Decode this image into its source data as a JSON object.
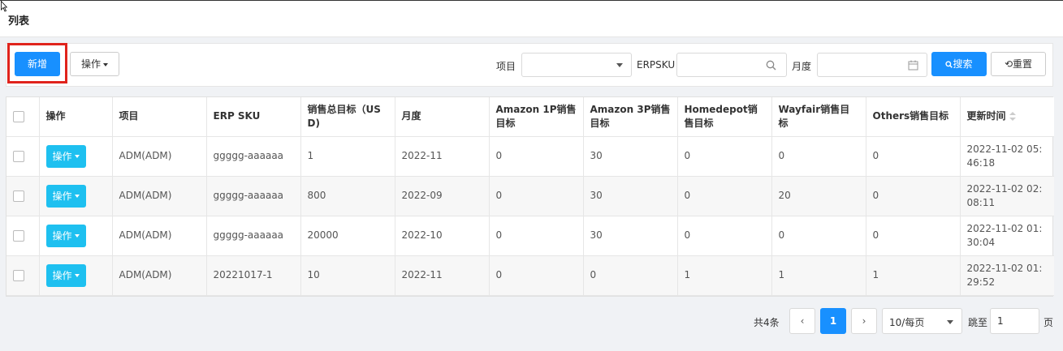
{
  "page": {
    "title": "列表"
  },
  "toolbar": {
    "add_label": "新增",
    "ops_label": "操作",
    "filters": {
      "project_label": "项目",
      "project_value": "",
      "erpsku_label": "ERPSKU",
      "erpsku_value": "",
      "month_label": "月度",
      "month_value": ""
    },
    "search_label": "搜索",
    "reset_label": "重置"
  },
  "table": {
    "headers": [
      "操作",
      "项目",
      "ERP SKU",
      "销售总目标（USD)",
      "月度",
      "Amazon 1P销售目标",
      "Amazon 3P销售目标",
      "Homedepot销售目标",
      "Wayfair销售目标",
      "Others销售目标",
      "更新时间"
    ],
    "row_action_label": "操作",
    "rows": [
      [
        "ADM(ADM)",
        "ggggg-aaaaaa",
        "1",
        "2022-11",
        "0",
        "30",
        "0",
        "0",
        "0",
        "2022-11-02 05:46:18"
      ],
      [
        "ADM(ADM)",
        "ggggg-aaaaaa",
        "800",
        "2022-09",
        "0",
        "30",
        "0",
        "20",
        "0",
        "2022-11-02 02:08:11"
      ],
      [
        "ADM(ADM)",
        "ggggg-aaaaaa",
        "20000",
        "2022-10",
        "0",
        "30",
        "0",
        "0",
        "0",
        "2022-11-02 01:30:04"
      ],
      [
        "ADM(ADM)",
        "20221017-1",
        "10",
        "2022-11",
        "0",
        "0",
        "1",
        "1",
        "1",
        "2022-11-02 01:29:52"
      ]
    ]
  },
  "pagination": {
    "total_text": "共4条",
    "current_page": "1",
    "page_size": "10/每页",
    "jump_label": "跳至",
    "jump_value": "1",
    "page_suffix": "页"
  },
  "colors": {
    "primary": "#1890ff",
    "row_button": "#1ec0f0",
    "highlight": "#e0231c"
  }
}
